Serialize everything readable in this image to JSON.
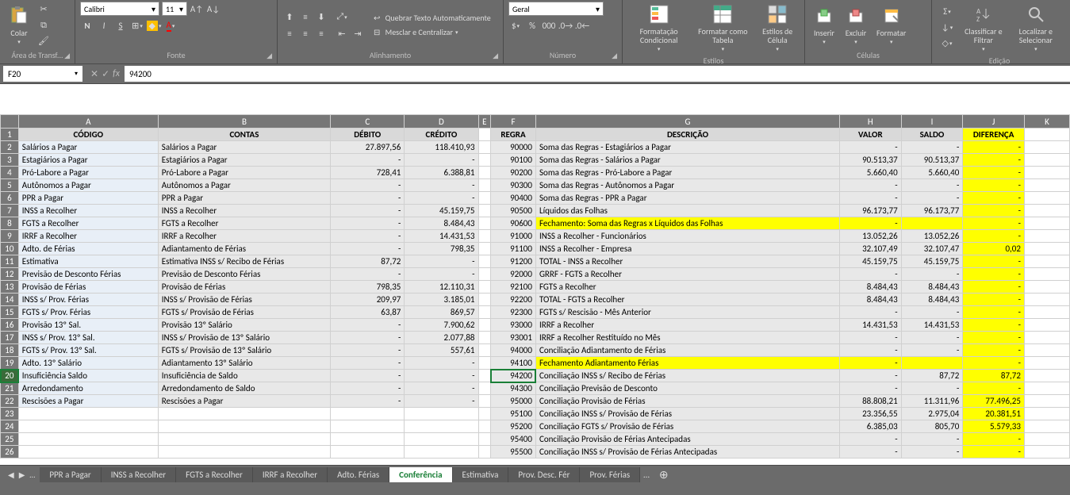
{
  "ribbon": {
    "clipboard": {
      "paste": "Colar",
      "label": "Área de Transf..."
    },
    "font": {
      "name": "Calibri",
      "size": "11",
      "label": "Fonte",
      "bold": "N",
      "italic": "I",
      "underline": "S"
    },
    "align": {
      "wrap": "Quebrar Texto Automaticamente",
      "merge": "Mesclar e Centralizar",
      "label": "Alinhamento"
    },
    "number": {
      "format": "Geral",
      "label": "Número"
    },
    "styles": {
      "cond": "Formatação Condicional",
      "table": "Formatar como Tabela",
      "cell": "Estilos de Célula",
      "label": "Estilos"
    },
    "cells": {
      "insert": "Inserir",
      "delete": "Excluir",
      "format": "Formatar",
      "label": "Células"
    },
    "edit": {
      "sort": "Classificar e Filtrar",
      "find": "Localizar e Selecionar",
      "label": "Edição"
    }
  },
  "formula": {
    "cell": "F20",
    "value": "94200"
  },
  "headers": {
    "a": "CÓDIGO",
    "b": "CONTAS",
    "c": "DÉBITO",
    "d": "CRÉDITO",
    "f": "REGRA",
    "g": "DESCRIÇÃO",
    "h": "VALOR",
    "i": "SALDO",
    "j": "DIFERENÇA"
  },
  "rows": [
    {
      "n": "2",
      "a": "Salários a Pagar",
      "b": "Salários a Pagar",
      "c": "27.897,56",
      "d": "118.410,93",
      "f": "90000",
      "g": "Soma das Regras - Estagiários a Pagar",
      "h": "-",
      "i": "-",
      "j": "-"
    },
    {
      "n": "3",
      "a": "Estagiários a Pagar",
      "b": "Estagiários a Pagar",
      "c": "-",
      "d": "-",
      "f": "90100",
      "g": "Soma das Regras - Salários a Pagar",
      "h": "90.513,37",
      "i": "90.513,37",
      "j": "-"
    },
    {
      "n": "4",
      "a": "Pró-Labore a Pagar",
      "b": "Pró-Labore a Pagar",
      "c": "728,41",
      "d": "6.388,81",
      "f": "90200",
      "g": "Soma das Regras - Pró-Labore a Pagar",
      "h": "5.660,40",
      "i": "5.660,40",
      "j": "-"
    },
    {
      "n": "5",
      "a": "Autônomos a Pagar",
      "b": "Autônomos a Pagar",
      "c": "-",
      "d": "-",
      "f": "90300",
      "g": "Soma das Regras - Autônomos a Pagar",
      "h": "-",
      "i": "-",
      "j": "-"
    },
    {
      "n": "6",
      "a": "PPR a Pagar",
      "b": "PPR a Pagar",
      "c": "-",
      "d": "-",
      "f": "90400",
      "g": "Soma das Regras - PPR a Pagar",
      "h": "-",
      "i": "-",
      "j": "-"
    },
    {
      "n": "7",
      "a": "INSS a Recolher",
      "b": "INSS a Recolher",
      "c": "-",
      "d": "45.159,75",
      "f": "90500",
      "g": "Líquidos das Folhas",
      "h": "96.173,77",
      "i": "96.173,77",
      "j": "-"
    },
    {
      "n": "8",
      "a": "FGTS a Recolher",
      "b": "FGTS a Recolher",
      "c": "-",
      "d": "8.484,43",
      "f": "90600",
      "g": "Fechamento: Soma das Regras x Líquidos das Folhas",
      "h": "-",
      "i": "",
      "j": "-",
      "yl": true
    },
    {
      "n": "9",
      "a": "IRRF a Recolher",
      "b": "IRRF a Recolher",
      "c": "-",
      "d": "14.431,53",
      "f": "91000",
      "g": "INSS a Recolher - Funcionários",
      "h": "13.052,26",
      "i": "13.052,26",
      "j": "-"
    },
    {
      "n": "10",
      "a": "Adto. de Férias",
      "b": "Adiantamento de Férias",
      "c": "-",
      "d": "798,35",
      "f": "91100",
      "g": "INSS a Recolher - Empresa",
      "h": "32.107,49",
      "i": "32.107,47",
      "j": "0,02"
    },
    {
      "n": "11",
      "a": "Estimativa",
      "b": "Estimativa  INSS s/ Recibo de Férias",
      "c": "87,72",
      "d": "-",
      "f": "91200",
      "g": "TOTAL - INSS a Recolher",
      "h": "45.159,75",
      "i": "45.159,75",
      "j": "-"
    },
    {
      "n": "12",
      "a": "Previsão de  Desconto Férias",
      "b": "Previsão de  Desconto Férias",
      "c": "-",
      "d": "-",
      "f": "92000",
      "g": "GRRF - FGTS a Recolher",
      "h": "-",
      "i": "-",
      "j": "-"
    },
    {
      "n": "13",
      "a": "Provisão de Férias",
      "b": "Provisão de Férias",
      "c": "798,35",
      "d": "12.110,31",
      "f": "92100",
      "g": "FGTS a Recolher",
      "h": "8.484,43",
      "i": "8.484,43",
      "j": "-"
    },
    {
      "n": "14",
      "a": "INSS s/ Prov. Férias",
      "b": "INSS s/ Provisão de Férias",
      "c": "209,97",
      "d": "3.185,01",
      "f": "92200",
      "g": "TOTAL - FGTS a Recolher",
      "h": "8.484,43",
      "i": "8.484,43",
      "j": "-"
    },
    {
      "n": "15",
      "a": "FGTS s/ Prov. Férias",
      "b": "FGTS s/ Provisão de Férias",
      "c": "63,87",
      "d": "869,57",
      "f": "92300",
      "g": "FGTS s/ Rescisão - Mês Anterior",
      "h": "-",
      "i": "-",
      "j": "-"
    },
    {
      "n": "16",
      "a": "Provisão 13º Sal.",
      "b": "Provisão 13º Salário",
      "c": "-",
      "d": "7.900,62",
      "f": "93000",
      "g": "IRRF a Recolher",
      "h": "14.431,53",
      "i": "14.431,53",
      "j": "-"
    },
    {
      "n": "17",
      "a": "INSS s/ Prov. 13º Sal.",
      "b": "INSS s/ Provisão de 13º Salário",
      "c": "-",
      "d": "2.077,88",
      "f": "93001",
      "g": "IRRF a Recolher Restituído no Mês",
      "h": "-",
      "i": "-",
      "j": "-"
    },
    {
      "n": "18",
      "a": "FGTS s/ Prov. 13º Sal.",
      "b": "FGTS s/ Provisão de 13º Salário",
      "c": "-",
      "d": "557,61",
      "f": "94000",
      "g": "Conciliação Adiantamento de Férias",
      "h": "-",
      "i": "-",
      "j": "-"
    },
    {
      "n": "19",
      "a": "Adto. 13º Salário",
      "b": "Adiantamento 13º Salário",
      "c": "-",
      "d": "-",
      "f": "94100",
      "g": "Fechamento Adiantamento Férias",
      "h": "-",
      "i": "",
      "j": "-",
      "yl": true
    },
    {
      "n": "20",
      "a": "Insuficiência Saldo",
      "b": "Insuficiência de Saldo",
      "c": "-",
      "d": "-",
      "f": "94200",
      "g": "Conciliação INSS s/ Recibo de Férias",
      "h": "-",
      "i": "87,72",
      "j": "87,72",
      "selF": true
    },
    {
      "n": "21",
      "a": "Arredondamento",
      "b": "Arredondamento de Saldo",
      "c": "-",
      "d": "-",
      "f": "94300",
      "g": "Conciliação Previsão de Desconto",
      "h": "-",
      "i": "-",
      "j": "-"
    },
    {
      "n": "22",
      "a": "Rescisões a Pagar",
      "b": "Rescisões a Pagar",
      "c": "-",
      "d": "-",
      "f": "95000",
      "g": "Conciliação Provisão de Férias",
      "h": "88.808,21",
      "i": "11.311,96",
      "j": "77.496,25"
    },
    {
      "n": "23",
      "a": "",
      "b": "",
      "c": "",
      "d": "",
      "f": "95100",
      "g": "Conciliação INSS s/ Provisão de Férias",
      "h": "23.356,55",
      "i": "2.975,04",
      "j": "20.381,51"
    },
    {
      "n": "24",
      "a": "",
      "b": "",
      "c": "",
      "d": "",
      "f": "95200",
      "g": "Conciliação FGTS s/ Provisão de Férias",
      "h": "6.385,03",
      "i": "805,70",
      "j": "5.579,33"
    },
    {
      "n": "25",
      "a": "",
      "b": "",
      "c": "",
      "d": "",
      "f": "95400",
      "g": "Conciliação Provisão de Férias Antecipadas",
      "h": "-",
      "i": "-",
      "j": "-"
    },
    {
      "n": "26",
      "a": "",
      "b": "",
      "c": "",
      "d": "",
      "f": "95500",
      "g": "Conciliação INSS s/ Provisão de Férias Antecipadas",
      "h": "-",
      "i": "-",
      "j": "-"
    }
  ],
  "tabs": {
    "items": [
      "PPR a Pagar",
      "INSS a Recolher",
      "FGTS a Recolher",
      "IRRF a Recolher",
      "Adto. Férias",
      "Conferência",
      "Estimativa",
      "Prov. Desc. Fér",
      "Prov. Férias"
    ],
    "active": 5
  }
}
